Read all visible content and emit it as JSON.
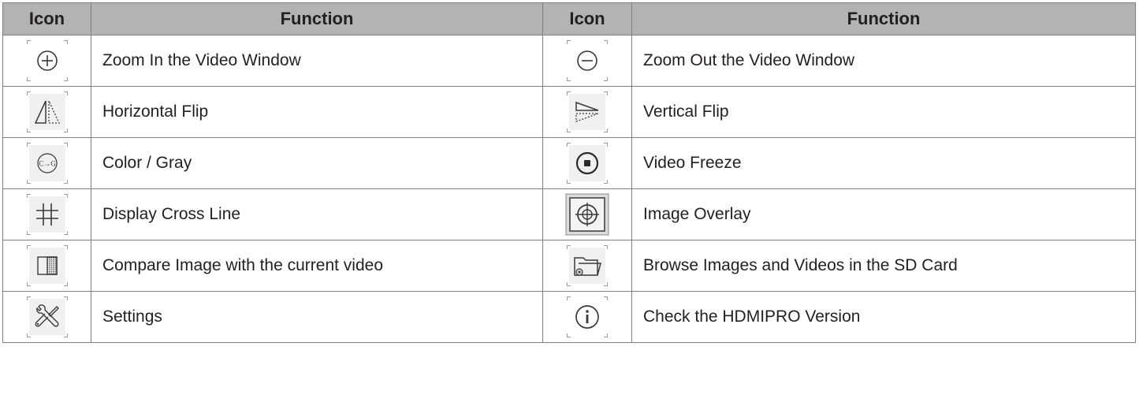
{
  "headers": {
    "icon_left": "Icon",
    "function_left": "Function",
    "icon_right": "Icon",
    "function_right": "Function"
  },
  "rows": [
    {
      "left": {
        "icon": "zoom-in-icon",
        "function": "Zoom In the Video Window"
      },
      "right": {
        "icon": "zoom-out-icon",
        "function": "Zoom Out the Video Window"
      }
    },
    {
      "left": {
        "icon": "horizontal-flip-icon",
        "function": "Horizontal Flip"
      },
      "right": {
        "icon": "vertical-flip-icon",
        "function": "Vertical Flip"
      }
    },
    {
      "left": {
        "icon": "color-gray-icon",
        "icon_text": "C→G",
        "function": "Color / Gray"
      },
      "right": {
        "icon": "video-freeze-icon",
        "function": "Video Freeze"
      }
    },
    {
      "left": {
        "icon": "cross-line-icon",
        "function": "Display Cross Line"
      },
      "right": {
        "icon": "image-overlay-icon",
        "function": "Image Overlay"
      }
    },
    {
      "left": {
        "icon": "compare-image-icon",
        "function": "Compare Image with the current video"
      },
      "right": {
        "icon": "browse-folder-icon",
        "function": "Browse Images and Videos in the SD Card"
      }
    },
    {
      "left": {
        "icon": "settings-tools-icon",
        "function": "Settings"
      },
      "right": {
        "icon": "info-icon",
        "function": "Check the HDMIPRO Version"
      }
    }
  ],
  "colors": {
    "header_bg": "#b3b3b3",
    "border": "#7f7f7f",
    "text": "#231f20",
    "icon_stroke": "#3a3a3a",
    "icon_bg": "#f0f0f0"
  }
}
